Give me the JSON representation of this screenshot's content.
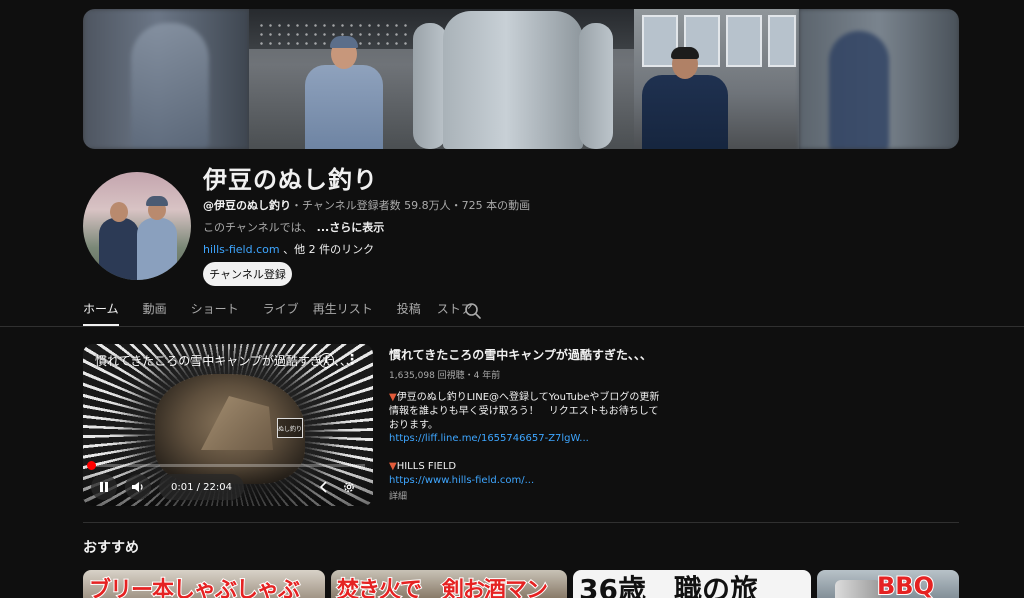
{
  "channel": {
    "name": "伊豆のぬし釣り",
    "handle": "@伊豆のぬし釣り",
    "meta_rest": "・チャンネル登録者数 59.8万人・725 本の動画",
    "description": "このチャンネルでは、",
    "more_label": "...さらに表示",
    "link_text": "hills-field.com",
    "link_rest": " 、他 2 件のリンク",
    "subscribe_label": "チャンネル登録"
  },
  "tabs": [
    {
      "label": "ホーム",
      "active": true
    },
    {
      "label": "動画"
    },
    {
      "label": "ショート"
    },
    {
      "label": "ライブ"
    },
    {
      "label": "再生リスト"
    },
    {
      "label": "投稿"
    },
    {
      "label": "ストア"
    }
  ],
  "featured": {
    "player_title": "慣れてきたころの雪中キャンプが過酷すぎた、、、",
    "logo_text": "ぬし釣り",
    "time": "0:01 / 22:04",
    "progress": 0.001,
    "title": "慣れてきたころの雪中キャンプが過酷すぎた、、、",
    "stats": "1,635,098 回視聴・4 年前",
    "desc_marker": "▼",
    "desc": "伊豆のぬし釣りLINE@へ登録してYouTubeやブログの更新情報を誰よりも早く受け取ろう！　リクエストもお待ちしております。",
    "link1": "https://liff.line.me/1655746657-Z7lgW...",
    "hills_label": "HILLS FIELD",
    "link2": "https://www.hills-field.com/...",
    "detail_label": "詳細"
  },
  "recommended": {
    "title": "おすすめ",
    "thumbs": [
      {
        "text": "ブリー本しゃぶしゃぶ"
      },
      {
        "text": "焚き火で　剣お酒マン"
      },
      {
        "text": "36歳　職の旅"
      },
      {
        "text": "BBQ"
      }
    ]
  },
  "colors": {
    "background": "#0f0f0f",
    "link": "#3ea6ff",
    "progress": "#ff0000"
  }
}
